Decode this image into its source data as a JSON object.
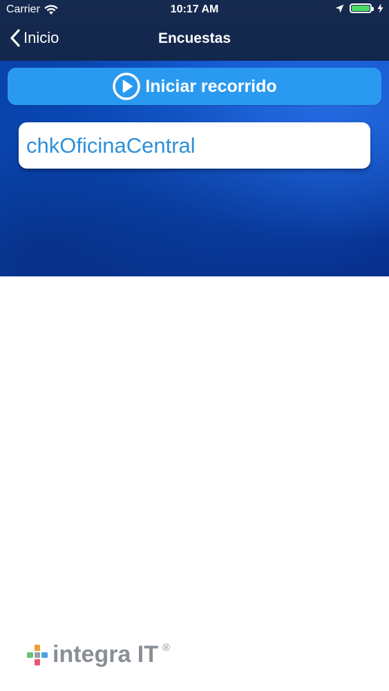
{
  "status_bar": {
    "carrier": "Carrier",
    "time": "10:17 AM",
    "battery_level": 1.0,
    "battery_color": "#4cd964",
    "icons": [
      "wifi-icon",
      "location-arrow-icon",
      "battery-icon",
      "charging-bolt-icon"
    ]
  },
  "nav": {
    "back_label": "Inicio",
    "title": "Encuestas"
  },
  "actions": {
    "start_label": "Iniciar recorrido",
    "start_icon": "play-circle-icon"
  },
  "surveys": [
    {
      "label": "chkOficinaCentral"
    }
  ],
  "footer": {
    "logo_text": "integra IT",
    "logo_mark": "®"
  },
  "colors": {
    "primary_button": "#2a9af0",
    "survey_text": "#2f8fd8",
    "nav_background": "#14284e",
    "logo_grey": "#8a8f96"
  }
}
